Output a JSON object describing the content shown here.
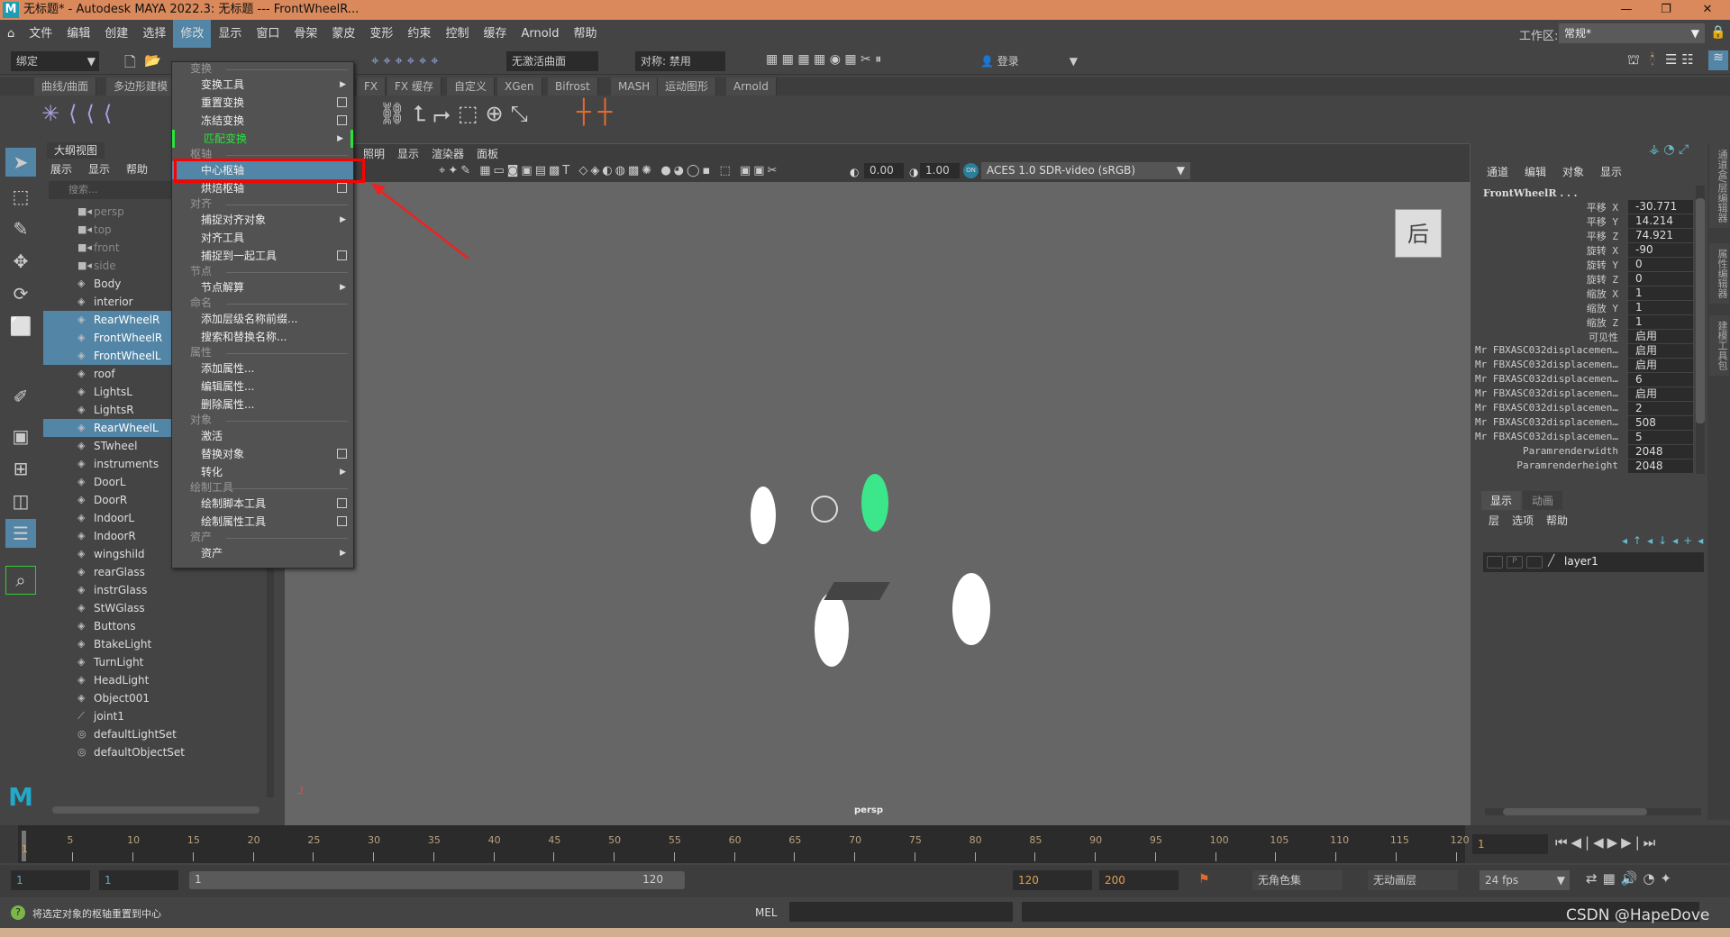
{
  "titlebar": {
    "text": "无标题* - Autodesk MAYA 2022.3: 无标题   ---   FrontWheelR...",
    "logo": "M"
  },
  "menubar": [
    "文件",
    "编辑",
    "创建",
    "选择",
    "修改",
    "显示",
    "窗口",
    "骨架",
    "蒙皮",
    "变形",
    "约束",
    "控制",
    "缓存",
    "Arnold",
    "帮助"
  ],
  "menubar_active": "修改",
  "toolbar": {
    "mode": "绑定",
    "no_live_surface": "无激活曲面",
    "symmetry": "对称: 禁用",
    "login": "登录",
    "workspace_label": "工作区:",
    "workspace_value": "常规*"
  },
  "shelf_tabs": [
    "曲线/曲面",
    "多边形建模",
    "FX",
    "FX 缓存",
    "自定义",
    "XGen",
    "Bifrost",
    "MASH",
    "运动图形",
    "Arnold"
  ],
  "outliner": {
    "title": "大纲视图",
    "menu": [
      "展示",
      "显示",
      "帮助"
    ],
    "search_placeholder": "搜索...",
    "items": [
      {
        "label": "persp",
        "type": "camera"
      },
      {
        "label": "top",
        "type": "camera"
      },
      {
        "label": "front",
        "type": "camera"
      },
      {
        "label": "side",
        "type": "camera"
      },
      {
        "label": "Body"
      },
      {
        "label": "interior"
      },
      {
        "label": "RearWheelR",
        "selected": true
      },
      {
        "label": "FrontWheelR",
        "selected": true
      },
      {
        "label": "FrontWheelL",
        "selected": true
      },
      {
        "label": "roof"
      },
      {
        "label": "LightsL"
      },
      {
        "label": "LightsR"
      },
      {
        "label": "RearWheelL",
        "selected": true
      },
      {
        "label": "STwheel"
      },
      {
        "label": "instruments"
      },
      {
        "label": "DoorL"
      },
      {
        "label": "DoorR"
      },
      {
        "label": "IndoorL"
      },
      {
        "label": "IndoorR"
      },
      {
        "label": "wingshild"
      },
      {
        "label": "rearGlass"
      },
      {
        "label": "instrGlass"
      },
      {
        "label": "StWGlass"
      },
      {
        "label": "Buttons"
      },
      {
        "label": "BtakeLight"
      },
      {
        "label": "TurnLight"
      },
      {
        "label": "HeadLight"
      },
      {
        "label": "Object001"
      },
      {
        "label": "joint1",
        "type": "joint"
      },
      {
        "label": "defaultLightSet",
        "type": "set"
      },
      {
        "label": "defaultObjectSet",
        "type": "set"
      }
    ]
  },
  "dropdown": [
    {
      "label": "变换",
      "section": true
    },
    {
      "label": "变换工具",
      "submenu": true
    },
    {
      "label": "重置变换",
      "option": true
    },
    {
      "label": "冻结变换",
      "option": true
    },
    {
      "label": "匹配变换",
      "submenu": true,
      "green": true
    },
    {
      "label": "枢轴",
      "section": true
    },
    {
      "label": "中心枢轴",
      "highlight": true
    },
    {
      "label": "烘焙枢轴",
      "option": true
    },
    {
      "label": "对齐",
      "section": true
    },
    {
      "label": "捕捉对齐对象",
      "submenu": true
    },
    {
      "label": "对齐工具"
    },
    {
      "label": "捕捉到一起工具",
      "option": true
    },
    {
      "label": "节点",
      "section": true
    },
    {
      "label": "节点解算",
      "submenu": true
    },
    {
      "label": "命名",
      "section": true
    },
    {
      "label": "添加层级名称前缀..."
    },
    {
      "label": "搜索和替换名称..."
    },
    {
      "label": "属性",
      "section": true
    },
    {
      "label": "添加属性..."
    },
    {
      "label": "编辑属性..."
    },
    {
      "label": "删除属性..."
    },
    {
      "label": "对象",
      "section": true
    },
    {
      "label": "激活"
    },
    {
      "label": "替换对象",
      "option": true
    },
    {
      "label": "转化",
      "submenu": true
    },
    {
      "label": "绘制工具",
      "section": true
    },
    {
      "label": "绘制脚本工具",
      "option": true
    },
    {
      "label": "绘制属性工具",
      "option": true
    },
    {
      "label": "资产",
      "section": true
    },
    {
      "label": "资产",
      "submenu": true
    }
  ],
  "viewport": {
    "menu": [
      "照明",
      "显示",
      "渲染器",
      "面板"
    ],
    "exposure": "0.00",
    "gamma": "1.00",
    "colorspace": "ACES 1.0 SDR-video (sRGB)",
    "camera_label": "persp",
    "viewcube_face": "后"
  },
  "channelbox": {
    "menu": [
      "通道",
      "编辑",
      "对象",
      "显示"
    ],
    "object": "FrontWheelR . . .",
    "rows": [
      [
        "平移 X",
        "-30.771"
      ],
      [
        "平移 Y",
        "14.214"
      ],
      [
        "平移 Z",
        "74.921"
      ],
      [
        "旋转 X",
        "-90"
      ],
      [
        "旋转 Y",
        "0"
      ],
      [
        "旋转 Z",
        "0"
      ],
      [
        "缩放 X",
        "1"
      ],
      [
        "缩放 Y",
        "1"
      ],
      [
        "缩放 Z",
        "1"
      ],
      [
        "可见性",
        "启用"
      ],
      [
        "Mr FBXASC032displacemen…",
        "启用"
      ],
      [
        "Mr FBXASC032displacemen…",
        "启用"
      ],
      [
        "Mr FBXASC032displacemen…",
        "6"
      ],
      [
        "Mr FBXASC032displacemen…",
        "启用"
      ],
      [
        "Mr FBXASC032displacemen…",
        "2"
      ],
      [
        "Mr FBXASC032displacemen…",
        "508"
      ],
      [
        "Mr FBXASC032displacemen…",
        "5"
      ],
      [
        "Paramrenderwidth",
        "2048"
      ],
      [
        "Paramrenderheight",
        "2048"
      ]
    ]
  },
  "layers": {
    "tabs": [
      "显示",
      "动画"
    ],
    "menu": [
      "层",
      "选项",
      "帮助"
    ],
    "layer": "layer1",
    "p": "P"
  },
  "vtabs": [
    "通道盒/层编辑器",
    "属性编辑器",
    "建模工具包"
  ],
  "timeline": {
    "ticks": [
      5,
      10,
      15,
      20,
      25,
      30,
      35,
      40,
      45,
      50,
      55,
      60,
      65,
      70,
      75,
      80,
      85,
      90,
      95,
      100,
      105,
      110,
      115,
      120
    ],
    "current": "1",
    "current_field": "1"
  },
  "range": {
    "start": "1",
    "anim_start": "1",
    "slider_start": "1",
    "slider_end": "120",
    "end": "120",
    "anim_end": "200",
    "charset": "无角色集",
    "animlayer": "无动画层",
    "fps": "24 fps"
  },
  "cmd": {
    "help": "将选定对象的枢轴重置到中心",
    "lang": "MEL",
    "watermark": "CSDN @HapeDove"
  },
  "colors": {
    "accent": "#5285a6",
    "title": "#d9895b",
    "green": "#29e33a",
    "highlight_box": "#ff0000",
    "selected_wheel": "#3ce68a"
  }
}
